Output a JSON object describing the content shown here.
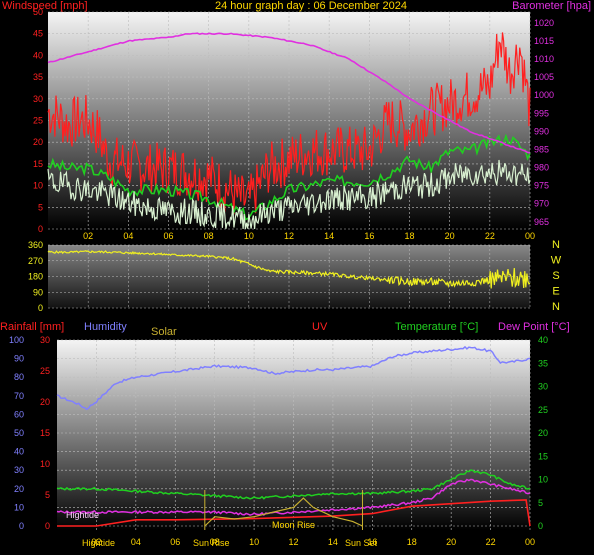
{
  "chart_data": [
    {
      "type": "line",
      "title": "24 hour graph day : 06 December 2024",
      "ylabel_left": "Windspeed [mph]",
      "ylabel_right": "Barometer [hpa]",
      "x_ticks": [
        "02",
        "04",
        "06",
        "08",
        "10",
        "12",
        "14",
        "16",
        "18",
        "20",
        "22",
        "00"
      ],
      "y_left_ticks": [
        0,
        5,
        10,
        15,
        20,
        25,
        30,
        35,
        40,
        45,
        50
      ],
      "y_right_ticks": [
        965,
        970,
        975,
        980,
        985,
        990,
        995,
        1000,
        1005,
        1010,
        1015,
        1020
      ],
      "ylim_left": [
        0,
        50
      ],
      "ylim_right": [
        963,
        1023
      ],
      "x_hours_range": [
        0,
        24
      ],
      "colors": {
        "gust": "#ff2020",
        "avg": "#20d020",
        "wind": "#d8f0d0",
        "baro": "#e030e0"
      },
      "series": [
        {
          "key": "gust",
          "color": "#ff2020",
          "x": [
            0,
            0.5,
            1,
            1.5,
            2,
            2.5,
            3,
            4,
            5,
            6,
            7,
            8,
            9,
            9.5,
            10,
            11,
            12,
            13,
            14,
            15,
            16,
            16.5,
            17,
            18,
            19,
            20,
            21,
            22,
            22.5,
            23,
            23.5,
            24
          ],
          "y": [
            27,
            26,
            24,
            25,
            25,
            22,
            16,
            15,
            14,
            14,
            13,
            12,
            9,
            7,
            6,
            14,
            16,
            18,
            18,
            18,
            18,
            22,
            25,
            23,
            27,
            29,
            31,
            33,
            44,
            36,
            42,
            27
          ]
        },
        {
          "key": "avg",
          "color": "#20d020",
          "x": [
            0,
            1,
            2,
            3,
            4,
            5,
            6,
            7,
            8,
            9,
            10,
            11,
            12,
            13,
            14,
            15,
            16,
            17,
            18,
            19,
            20,
            21,
            22,
            23,
            24
          ],
          "y": [
            15,
            14,
            14,
            12,
            9,
            9,
            9,
            8,
            7,
            5,
            3,
            6,
            9,
            10,
            11,
            11,
            11,
            13,
            16,
            14,
            18,
            18,
            20,
            21,
            17
          ]
        },
        {
          "key": "wind",
          "color": "#d8f0d0",
          "x": [
            0,
            1,
            2,
            3,
            4,
            5,
            6,
            7,
            8,
            9,
            10,
            11,
            12,
            13,
            14,
            15,
            16,
            17,
            18,
            19,
            20,
            21,
            22,
            23,
            24
          ],
          "y": [
            11,
            10,
            9,
            8,
            6,
            5,
            4,
            4,
            3,
            3,
            2,
            4,
            5,
            6,
            7,
            7,
            7,
            9,
            10,
            10,
            12,
            13,
            13,
            13,
            12
          ]
        },
        {
          "key": "baro",
          "color": "#e030e0",
          "x": [
            0,
            2,
            4,
            6,
            7,
            9,
            11,
            13,
            15,
            17,
            18,
            19,
            20,
            21,
            22,
            23,
            24
          ],
          "y": [
            1009,
            1012,
            1015,
            1016,
            1017,
            1017,
            1016,
            1014,
            1010,
            1003,
            999,
            996,
            993,
            990,
            988,
            986,
            984
          ]
        }
      ]
    },
    {
      "type": "line",
      "ylabel": "Wind direction",
      "y_ticks": [
        360,
        270,
        180,
        90,
        0
      ],
      "direction_labels": [
        "N",
        "W",
        "S",
        "E",
        "N"
      ],
      "color": "#f0f020",
      "x": [
        0,
        1,
        2,
        3,
        4,
        5,
        6,
        7,
        8,
        9,
        9.5,
        10,
        11,
        12,
        13,
        14,
        15,
        16,
        17,
        18,
        19,
        20,
        21,
        22,
        23,
        24
      ],
      "y": [
        320,
        318,
        322,
        320,
        315,
        312,
        305,
        300,
        295,
        285,
        270,
        250,
        210,
        205,
        200,
        195,
        180,
        170,
        160,
        150,
        150,
        140,
        145,
        160,
        170,
        175
      ]
    },
    {
      "type": "line",
      "labels": {
        "rain": "Rainfall [mm]",
        "humidity": "Humidity",
        "solar": "Solar",
        "uv": "UV",
        "temp": "Temperature [°C]",
        "dew": "Dew Point [°C]"
      },
      "y_rain_ticks": [
        0,
        5,
        10,
        15,
        20,
        25,
        30
      ],
      "y_hum_ticks": [
        0,
        10,
        20,
        30,
        40,
        50,
        60,
        70,
        80,
        90,
        100
      ],
      "y_temp_ticks": [
        0,
        5,
        10,
        15,
        20,
        25,
        30,
        35,
        40
      ],
      "annotations": {
        "hightide_left": "Hightide",
        "hightide_mid": "Hightide",
        "sunrise": "Sun Rise",
        "moonrise": "Moon Rise",
        "sunset": "Sun Set"
      },
      "series": [
        {
          "key": "humidity",
          "color": "#8080ff",
          "x": [
            0,
            1,
            1.5,
            2,
            3,
            4,
            6,
            8,
            10,
            11,
            12,
            13,
            14,
            15,
            16,
            17,
            18,
            19,
            20,
            21,
            22,
            22.5,
            23,
            24
          ],
          "y": [
            70,
            66,
            63,
            67,
            77,
            80,
            83,
            86,
            85,
            82,
            83,
            84,
            84,
            85,
            86,
            91,
            93,
            94,
            95,
            96,
            94,
            88,
            88,
            90
          ]
        },
        {
          "key": "temp",
          "color": "#20d020",
          "x": [
            0,
            2,
            4,
            6,
            8,
            10,
            12,
            14,
            16,
            18,
            19,
            20,
            21,
            22,
            23,
            24
          ],
          "y": [
            8,
            8,
            7.5,
            7,
            6.5,
            6,
            6.5,
            7,
            7,
            7.5,
            8,
            10,
            12,
            11,
            9,
            8
          ]
        },
        {
          "key": "dew",
          "color": "#e030e0",
          "x": [
            0,
            2,
            4,
            6,
            8,
            10,
            12,
            14,
            16,
            18,
            19,
            20,
            21,
            22,
            23,
            24
          ],
          "y": [
            3,
            3,
            3,
            3,
            3,
            2.5,
            3,
            3.5,
            4,
            5,
            6,
            9,
            10,
            9,
            8,
            7
          ]
        },
        {
          "key": "rain",
          "color": "#ff2020",
          "x": [
            0,
            2,
            4,
            6,
            8,
            10,
            12,
            14,
            16,
            18,
            20,
            22,
            23.8,
            24
          ],
          "y": [
            0,
            0,
            1,
            1,
            1.1,
            1.2,
            1.4,
            1.6,
            2,
            3.2,
            3.6,
            4,
            4.2,
            0
          ]
        },
        {
          "key": "solar",
          "color": "#c8b030",
          "x": [
            7.5,
            8,
            9,
            10,
            11,
            12,
            12.5,
            13,
            14,
            15,
            15.5
          ],
          "y": [
            0,
            2,
            1.5,
            2,
            3,
            4,
            6,
            4,
            2,
            1,
            0
          ]
        }
      ]
    }
  ]
}
